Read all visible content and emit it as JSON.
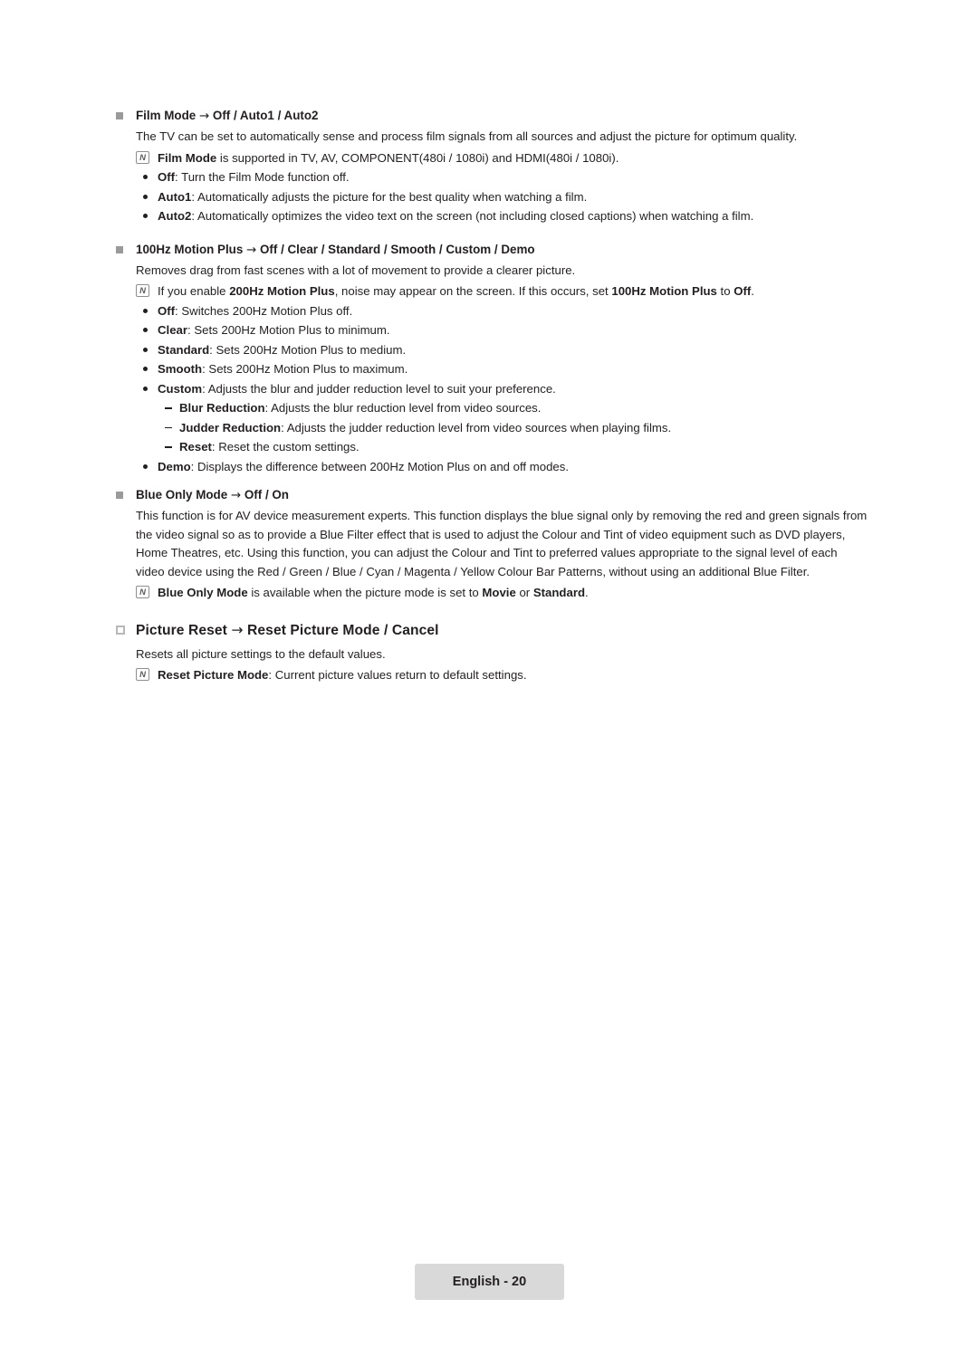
{
  "page": {
    "footer_label": "English - 20"
  },
  "sections": [
    {
      "heading_plain": "Film Mode",
      "heading_arrow": "→",
      "heading_options": "Off / Auto1 / Auto2",
      "intro": "The TV can be set to automatically sense and process film signals from all sources and adjust the picture for optimum quality.",
      "note1_bold": "Film Mode",
      "note1_rest": " is supported in TV, AV, COMPONENT(480i / 1080i) and HDMI(480i / 1080i).",
      "bullets": [
        {
          "term": "Off",
          "desc": ": Turn the Film Mode function off."
        },
        {
          "term": "Auto1",
          "desc": ": Automatically adjusts the picture for the best quality when watching a film."
        },
        {
          "term": "Auto2",
          "desc": ": Automatically optimizes the video text on the screen (not including closed captions) when watching a film."
        }
      ]
    },
    {
      "heading_plain": "100Hz Motion Plus",
      "heading_arrow": "→",
      "heading_options": "Off / Clear / Standard / Smooth / Custom / Demo",
      "intro": "Removes drag from fast scenes with a lot of movement to provide a clearer picture.",
      "note1_a": "If you enable ",
      "note1_b1": "200Hz Motion Plus",
      "note1_c": ", noise may appear on the screen. If this occurs, set ",
      "note1_b2": "100Hz Motion Plus",
      "note1_d": " to ",
      "note1_b3": "Off",
      "note1_e": ".",
      "bullets": [
        {
          "term": "Off",
          "desc": ": Switches 200Hz Motion Plus off."
        },
        {
          "term": "Clear",
          "desc": ": Sets 200Hz Motion Plus to minimum."
        },
        {
          "term": "Standard",
          "desc": ": Sets 200Hz Motion Plus to medium."
        },
        {
          "term": "Smooth",
          "desc": ": Sets 200Hz Motion Plus to maximum."
        },
        {
          "term": "Custom",
          "desc": ": Adjusts the blur and judder reduction level to suit your preference."
        }
      ],
      "subbullets": [
        {
          "term": "Blur Reduction",
          "desc": ": Adjusts the blur reduction level from video sources."
        },
        {
          "term": "Judder Reduction",
          "desc": ": Adjusts the judder reduction level from video sources when playing films."
        },
        {
          "term": "Reset",
          "desc": ": Reset the custom settings."
        }
      ],
      "last_bullet": {
        "term": "Demo",
        "desc": ": Displays the difference between 200Hz Motion Plus on and off modes."
      }
    },
    {
      "heading_plain": "Blue Only Mode",
      "heading_arrow": "→",
      "heading_options": "Off / On",
      "paragraph": "This function is for AV device measurement experts. This function displays the blue signal only by removing the red and green signals from the video signal so as to provide a Blue Filter effect that is used to adjust the Colour and Tint of video equipment such as DVD players, Home Theatres, etc. Using this function, you can adjust the Colour and Tint to preferred values appropriate to the signal level of each video device using the Red / Green / Blue / Cyan / Magenta / Yellow Colour Bar Patterns, without using an additional Blue Filter.",
      "note_b1": "Blue Only Mode",
      "note_a": " is available when the picture mode is set to ",
      "note_b2": "Movie",
      "note_c": " or ",
      "note_b3": "Standard",
      "note_d": "."
    }
  ],
  "picture_reset": {
    "heading_plain": "Picture Reset",
    "heading_arrow": "→",
    "heading_options": "Reset Picture Mode / Cancel",
    "intro": "Resets all picture settings to the default values.",
    "note_b": "Reset Picture Mode",
    "note_rest": ": Current picture values return to default settings."
  },
  "icons": {
    "note_letter": "N"
  }
}
